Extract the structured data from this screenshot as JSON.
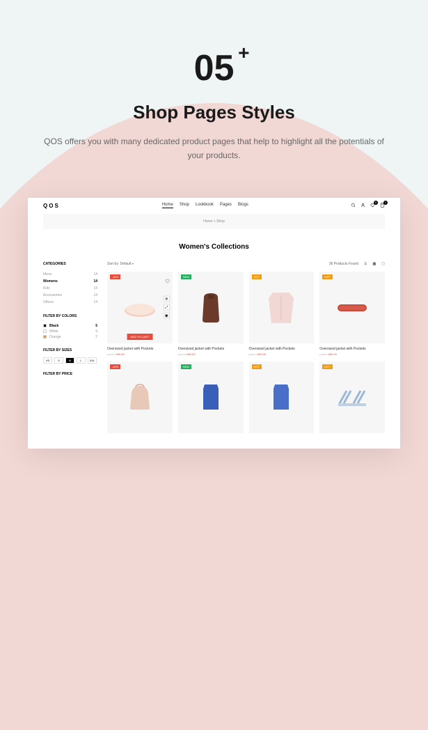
{
  "hero": {
    "number": "05",
    "plus": "+",
    "title": "Shop Pages Styles",
    "desc": "QOS offers you with many dedicated product pages that help to highlight all the potentials of your products."
  },
  "mockup": {
    "logo": "QOS",
    "nav": [
      "Home",
      "Shop",
      "Lookbook",
      "Pages",
      "Blogs"
    ],
    "breadcrumb": "Home > Shop",
    "page_title": "Women's Collections",
    "sort_label": "Sort by:",
    "sort_value": "Default",
    "results_text": "36 Products Found",
    "sidebar": {
      "categories_title": "CATEGORIES",
      "categories": [
        {
          "label": "Mens",
          "count": "14",
          "active": false
        },
        {
          "label": "Womens",
          "count": "14",
          "active": true
        },
        {
          "label": "Kids",
          "count": "14",
          "active": false
        },
        {
          "label": "Accessories",
          "count": "14",
          "active": false
        },
        {
          "label": "Others",
          "count": "14",
          "active": false
        }
      ],
      "colors_title": "FILTER BY COLORS",
      "colors": [
        {
          "label": "Black",
          "hex": "#000000",
          "count": "5",
          "active": true
        },
        {
          "label": "White",
          "hex": "#ffffff",
          "count": "9",
          "active": false
        },
        {
          "label": "Orange",
          "hex": "#f39c12",
          "count": "2",
          "active": false
        }
      ],
      "sizes_title": "FILTER BY SIZES",
      "sizes": [
        {
          "label": "XS",
          "active": false
        },
        {
          "label": "S",
          "active": false
        },
        {
          "label": "M",
          "active": true
        },
        {
          "label": "L",
          "active": false
        },
        {
          "label": "XXL",
          "active": false
        }
      ],
      "price_title": "FILTER BY PRICE"
    },
    "products": [
      {
        "badge": "-40%",
        "badge_color": "#e74c3c",
        "name": "Oversized jacket with Pockets",
        "sub": "parent",
        "price": "£89.00",
        "featured": true
      },
      {
        "badge": "NEW",
        "badge_color": "#27ae60",
        "name": "Oversized jacket with Pockets",
        "sub": "parent",
        "price": "£89.00"
      },
      {
        "badge": "HOT",
        "badge_color": "#f39c12",
        "name": "Oversized jacket with Pockets",
        "sub": "parent",
        "price": "£89.00"
      },
      {
        "badge": "HOT",
        "badge_color": "#f39c12",
        "name": "Oversized jacket with Pockets",
        "sub": "parent",
        "price": "£89.00"
      },
      {
        "badge": "-40%",
        "badge_color": "#e74c3c"
      },
      {
        "badge": "NEW",
        "badge_color": "#27ae60"
      },
      {
        "badge": "HOT",
        "badge_color": "#f39c12"
      },
      {
        "badge": "HOT",
        "badge_color": "#f39c12"
      }
    ],
    "add_to_cart": "ADD TO CART"
  }
}
